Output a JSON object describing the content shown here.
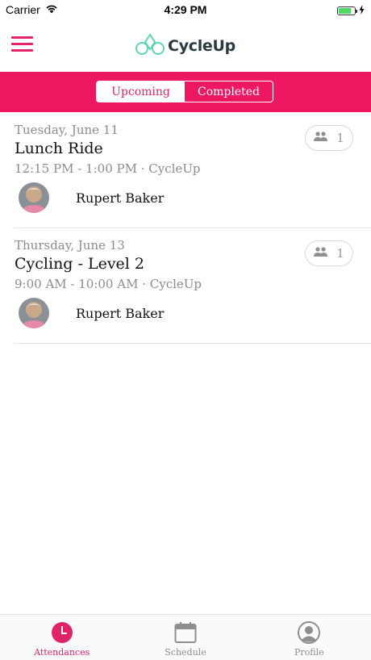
{
  "status_bar": {
    "carrier": "Carrier",
    "time": "4:29 PM",
    "battery_level": 0.8
  },
  "header": {
    "brand": "CycleUp",
    "menu_icon": "hamburger-menu-icon",
    "logo_icon": "bicycle-logo-icon"
  },
  "tabs": {
    "upcoming": "Upcoming",
    "completed": "Completed",
    "active": "upcoming"
  },
  "classes": [
    {
      "date": "Tuesday, June 11",
      "title": "Lunch Ride",
      "time": "12:15 PM - 1:00 PM · CycleUp",
      "instructor": "Rupert Baker",
      "attendees": "1"
    },
    {
      "date": "Thursday, June 13",
      "title": "Cycling - Level 2",
      "time": "9:00 AM - 10:00 AM · CycleUp",
      "instructor": "Rupert Baker",
      "attendees": "1"
    }
  ],
  "tab_bar": {
    "attendances": "Attendances",
    "schedule": "Schedule",
    "profile": "Profile",
    "active": "attendances"
  },
  "colors": {
    "accent": "#ee1862",
    "accent_text": "#e0246a",
    "brand_green": "#5fd6b2",
    "muted": "#8c8c8c"
  }
}
